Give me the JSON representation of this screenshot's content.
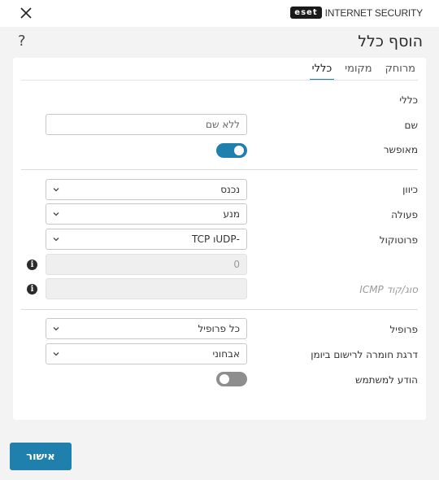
{
  "brand": {
    "logo": "eset",
    "product": "INTERNET SECURITY"
  },
  "header": {
    "title": "הוסף כלל",
    "help": "?"
  },
  "tabs": [
    {
      "label": "כללי",
      "active": true
    },
    {
      "label": "מקומי",
      "active": false
    },
    {
      "label": "מרוחק",
      "active": false
    }
  ],
  "section_general": {
    "heading": "כללי"
  },
  "name": {
    "label": "שם",
    "placeholder": "ללא שם",
    "value": ""
  },
  "enabled": {
    "label": "מאופשר",
    "on": true
  },
  "direction": {
    "label": "כיוון",
    "value": "נכנס"
  },
  "action": {
    "label": "פעולה",
    "value": "מנע"
  },
  "protocol": {
    "label": "פרוטוקול",
    "value": "UDP- TCP",
    "display": "-UDPו TCP"
  },
  "protocol_number": {
    "value": "0"
  },
  "icmp": {
    "label": "סוג/קוד ICMP",
    "value": ""
  },
  "profile": {
    "label": "פרופיל",
    "value": "כל פרופיל"
  },
  "log_severity": {
    "label": "דרגת חומרה לרישום ביומן",
    "value": "אבחוני"
  },
  "notify": {
    "label": "הודע למשתמש",
    "on": false
  },
  "footer": {
    "ok_label": "אישור"
  },
  "colors": {
    "accent": "#1f7fad",
    "toggle_off": "#8e8e8e",
    "background": "#f3f3f4"
  },
  "icons": {
    "close": "close-icon",
    "info": "info-icon",
    "chevron": "chevron-down-icon"
  }
}
